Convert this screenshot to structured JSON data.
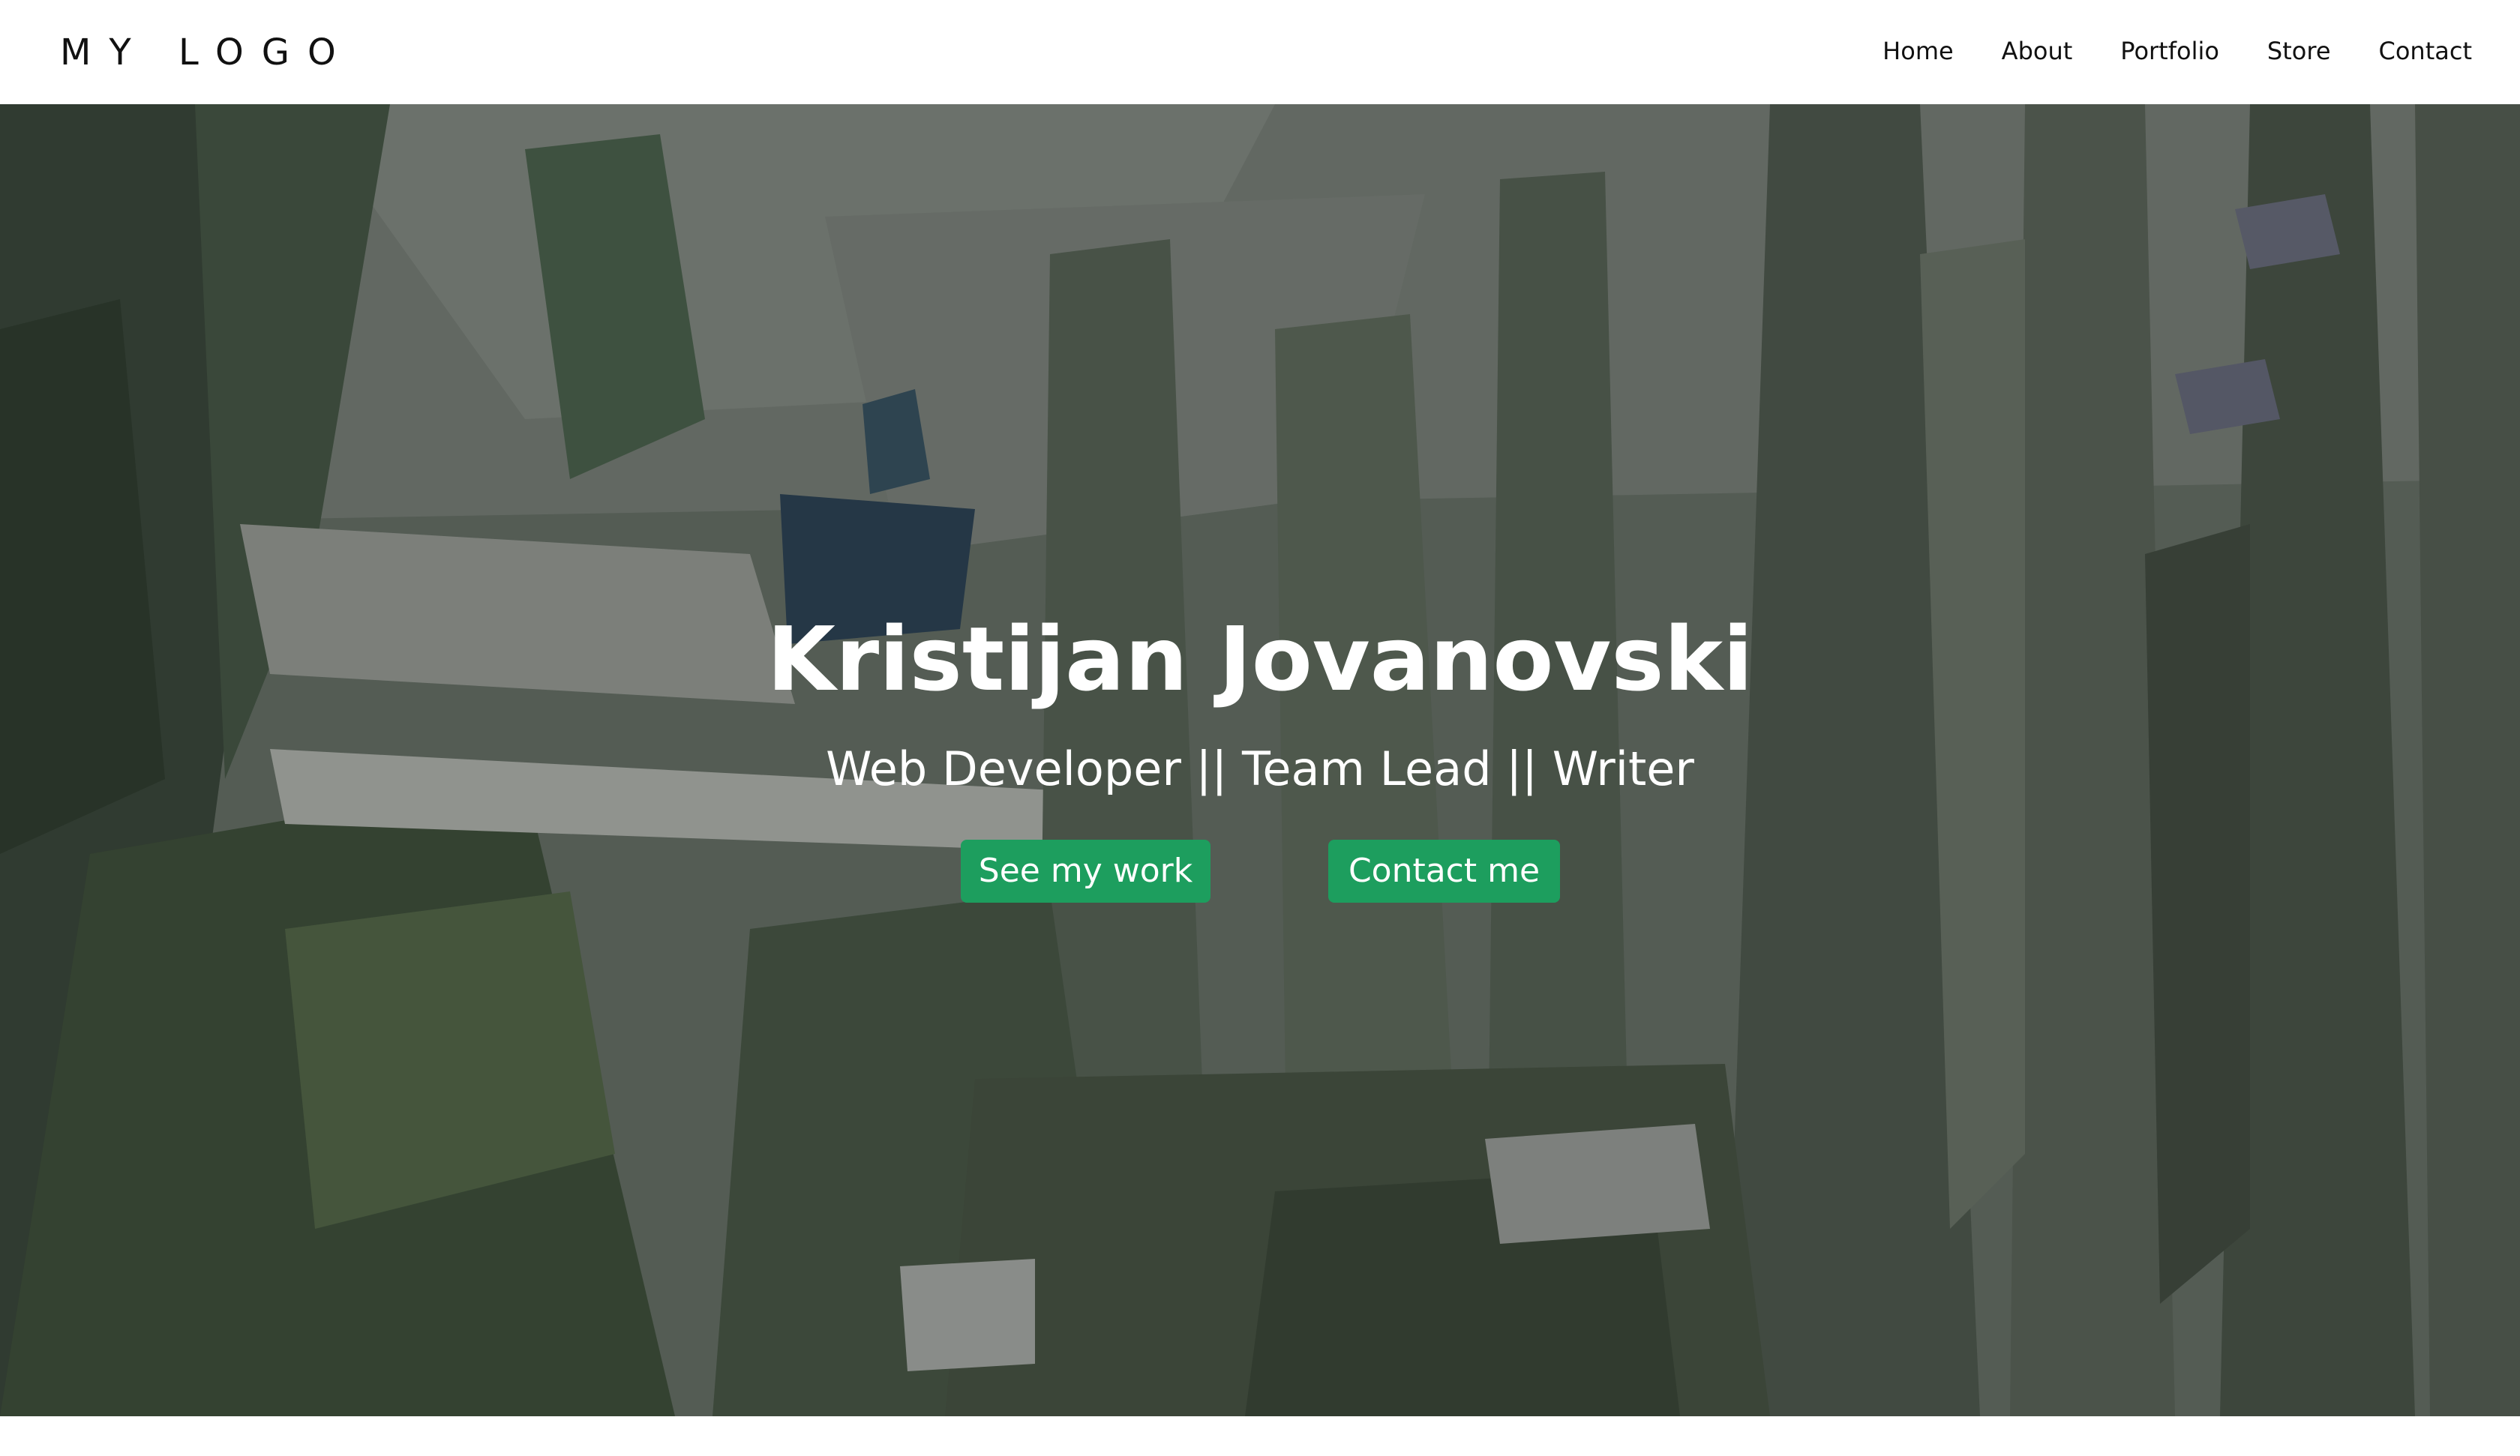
{
  "header": {
    "logo_text": "MY LOGO",
    "nav": [
      {
        "label": "Home"
      },
      {
        "label": "About"
      },
      {
        "label": "Portfolio"
      },
      {
        "label": "Store"
      },
      {
        "label": "Contact"
      }
    ]
  },
  "hero": {
    "title": "Kristijan Jovanovski",
    "subtitle": "Web Developer || Team Lead || Writer",
    "buttons": {
      "primary_label": "See my work",
      "secondary_label": "Contact me"
    },
    "colors": {
      "button_bg": "#1d9e5e",
      "text": "#ffffff"
    }
  }
}
